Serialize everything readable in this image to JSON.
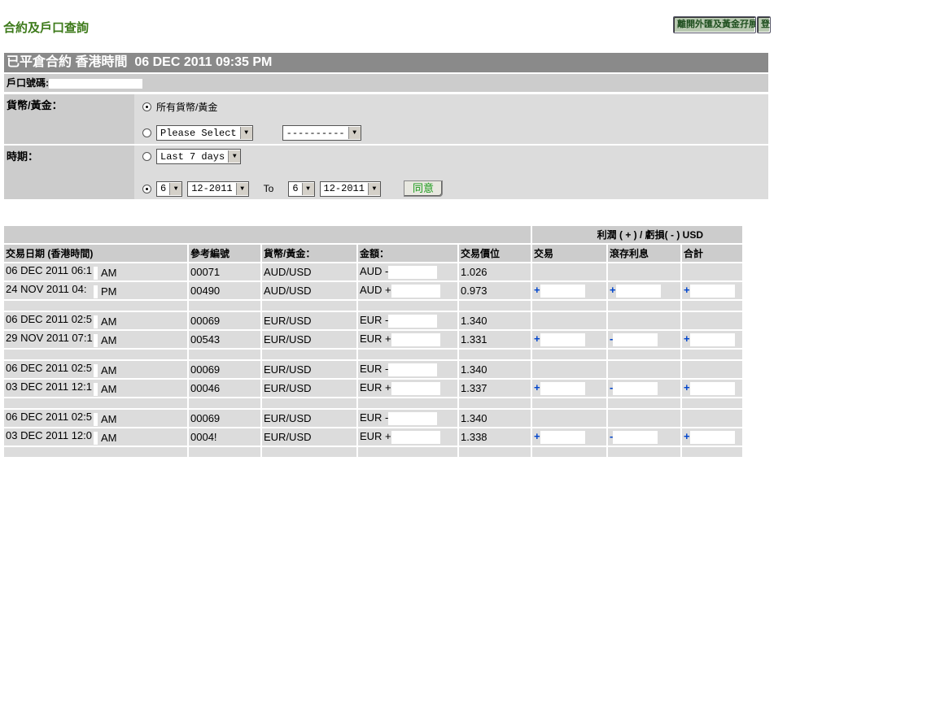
{
  "page_title": "合約及戶口查詢",
  "top_buttons": [
    "離開外匯及黃金孖展",
    "登"
  ],
  "header": {
    "title": "已平倉合約 香港時間",
    "datetime": "06 DEC 2011 09:35 PM"
  },
  "account": {
    "label": "戶口號碼:"
  },
  "filters": {
    "currency_label": "貨幣/黃金：",
    "all_option": "所有貨幣/黃金",
    "currency_select": "Please Select",
    "currency_select2": "----------",
    "period_label": "時期：",
    "period_select": "Last 7 days",
    "from_day": "6",
    "from_month": "12-2011",
    "to_label": "To",
    "to_day": "6",
    "to_month": "12-2011",
    "submit": "同意"
  },
  "table": {
    "group_header": "利潤 ( + ) / 虧損( - ) USD",
    "columns": [
      "交易日期 (香港時間)",
      "參考編號",
      "貨幣/黃金：",
      "金額：",
      "交易價位",
      "交易",
      "滾存利息",
      "合計"
    ],
    "groups": [
      [
        {
          "date": "06 DEC 2011 06:1",
          "ampm": "AM",
          "ref": "00071",
          "pair": "AUD/USD",
          "amount": "AUD -",
          "price": "1.026",
          "trade": "",
          "roll": "",
          "total": ""
        },
        {
          "date": "24 NOV 2011 04:",
          "ampm": "PM",
          "ref": "00490",
          "pair": "AUD/USD",
          "amount": "AUD +",
          "price": "0.973",
          "trade": "+",
          "roll": "+",
          "total": "+"
        }
      ],
      [
        {
          "date": "06 DEC 2011 02:5",
          "ampm": "AM",
          "ref": "00069",
          "pair": "EUR/USD",
          "amount": "EUR -",
          "price": "1.340",
          "trade": "",
          "roll": "",
          "total": ""
        },
        {
          "date": "29 NOV 2011 07:1",
          "ampm": "AM",
          "ref": "00543",
          "pair": "EUR/USD",
          "amount": "EUR +",
          "price": "1.331",
          "trade": "+",
          "roll": "-",
          "total": "+"
        }
      ],
      [
        {
          "date": "06 DEC 2011 02:5",
          "ampm": "AM",
          "ref": "00069",
          "pair": "EUR/USD",
          "amount": "EUR -",
          "price": "1.340",
          "trade": "",
          "roll": "",
          "total": ""
        },
        {
          "date": "03 DEC 2011 12:1",
          "ampm": "AM",
          "ref": "00046",
          "pair": "EUR/USD",
          "amount": "EUR +",
          "price": "1.337",
          "trade": "+",
          "roll": "-",
          "total": "+"
        }
      ],
      [
        {
          "date": "06 DEC 2011 02:5",
          "ampm": "AM",
          "ref": "00069",
          "pair": "EUR/USD",
          "amount": "EUR -",
          "price": "1.340",
          "trade": "",
          "roll": "",
          "total": ""
        },
        {
          "date": "03 DEC 2011 12:0",
          "ampm": "AM",
          "ref": "0004!",
          "pair": "EUR/USD",
          "amount": "EUR +",
          "price": "1.338",
          "trade": "+",
          "roll": "-",
          "total": "+"
        }
      ]
    ]
  }
}
